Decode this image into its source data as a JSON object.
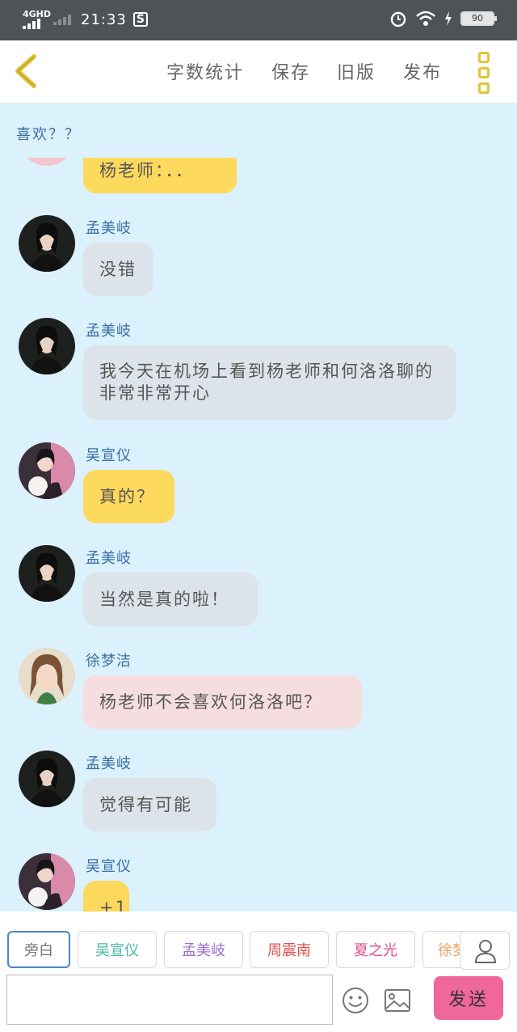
{
  "status_bar": {
    "network": "4GHD",
    "time": "21:33",
    "battery": "90",
    "icons": [
      "sim-icon",
      "alarm-icon",
      "wifi-icon",
      "charging-icon",
      "battery-icon"
    ]
  },
  "header": {
    "back_icon": "chevron-left-icon",
    "menu": [
      "字数统计",
      "保存",
      "旧版",
      "发布"
    ],
    "more_icon": "more-vertical-icon"
  },
  "chat_title": "喜欢？？",
  "messages": [
    {
      "name": "",
      "text": "杨老师：．．",
      "color": "yellow"
    },
    {
      "name": "孟美岐",
      "text": "没错",
      "color": "grey"
    },
    {
      "name": "孟美岐",
      "text": "我今天在机场上看到杨老师和何洛洛聊的非常非常开心",
      "color": "grey"
    },
    {
      "name": "吴宣仪",
      "text": "真的？",
      "color": "yellow"
    },
    {
      "name": "孟美岐",
      "text": "当然是真的啦！",
      "color": "grey"
    },
    {
      "name": "徐梦洁",
      "text": "杨老师不会喜欢何洛洛吧？",
      "color": "pink"
    },
    {
      "name": "孟美岐",
      "text": "觉得有可能",
      "color": "grey"
    },
    {
      "name": "吴宣仪",
      "text": "+1",
      "color": "yellow"
    }
  ],
  "roles": [
    {
      "label": "旁白",
      "color": "#777777"
    },
    {
      "label": "吴宣仪",
      "color": "#46b7a5"
    },
    {
      "label": "孟美岐",
      "color": "#9b6fd0"
    },
    {
      "label": "周震南",
      "color": "#e0504f"
    },
    {
      "label": "夏之光",
      "color": "#e0508a"
    },
    {
      "label": "徐梦洁",
      "color": "#f0a062"
    }
  ],
  "input": {
    "placeholder": "",
    "send_label": "发送",
    "emoji_icon": "emoji-icon",
    "image_icon": "image-icon",
    "user_icon": "user-icon"
  },
  "colors": {
    "background": "#dbf1fb",
    "bubble_yellow": "#fdd95e",
    "bubble_grey": "#dde3ea",
    "bubble_pink": "#f6dddf",
    "send_button": "#f0679b",
    "name_text": "#3a6ea5",
    "menu_icon": "#e2c43a"
  }
}
